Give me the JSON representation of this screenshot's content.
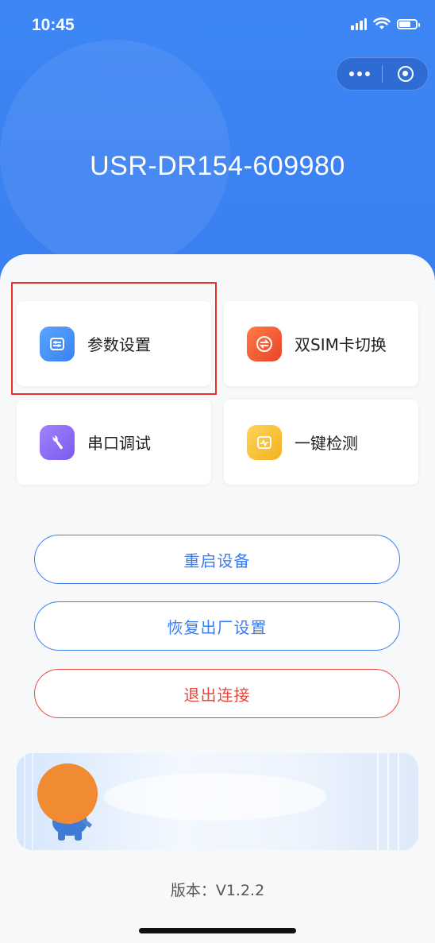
{
  "status_bar": {
    "time": "10:45"
  },
  "header": {
    "device_name": "USR-DR154-609980"
  },
  "cards": [
    {
      "label": "参数设置",
      "icon": "sliders-icon",
      "color": "#4a93f5"
    },
    {
      "label": "双SIM卡切换",
      "icon": "sim-switch-icon",
      "color": "#f0562c"
    },
    {
      "label": "串口调试",
      "icon": "wrench-icon",
      "color": "#8c6af0"
    },
    {
      "label": "一键检测",
      "icon": "pulse-icon",
      "color": "#f5c03a"
    }
  ],
  "buttons": {
    "restart": "重启设备",
    "factory_reset": "恢复出厂设置",
    "disconnect": "退出连接"
  },
  "footer": {
    "version": "版本：V1.2.2"
  },
  "colors": {
    "primary": "#3b7cf0",
    "danger": "#e8463f",
    "header_bg": "#3d86f4"
  }
}
